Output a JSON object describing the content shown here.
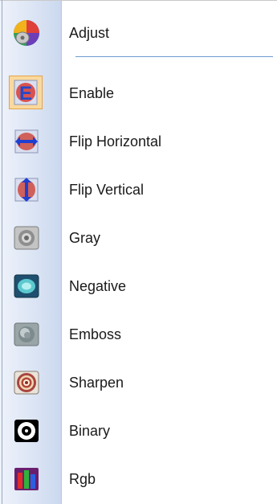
{
  "menu": {
    "items": [
      {
        "label": "Adjust",
        "icon": "adjust-color-wheel-icon"
      },
      {
        "label": "Enable",
        "icon": "enable-icon",
        "checked": true
      },
      {
        "label": "Flip Horizontal",
        "icon": "flip-horizontal-icon"
      },
      {
        "label": "Flip Vertical",
        "icon": "flip-vertical-icon"
      },
      {
        "label": "Gray",
        "icon": "gray-filter-icon"
      },
      {
        "label": "Negative",
        "icon": "negative-filter-icon"
      },
      {
        "label": "Emboss",
        "icon": "emboss-filter-icon"
      },
      {
        "label": "Sharpen",
        "icon": "sharpen-filter-icon"
      },
      {
        "label": "Binary",
        "icon": "binary-filter-icon"
      },
      {
        "label": "Rgb",
        "icon": "rgb-filter-icon"
      }
    ]
  },
  "colors": {
    "separator": "#6d9bd0",
    "checked_background": "#fbd99d",
    "checked_border": "#e3a44a",
    "icon_strip": "#dde6f5"
  }
}
